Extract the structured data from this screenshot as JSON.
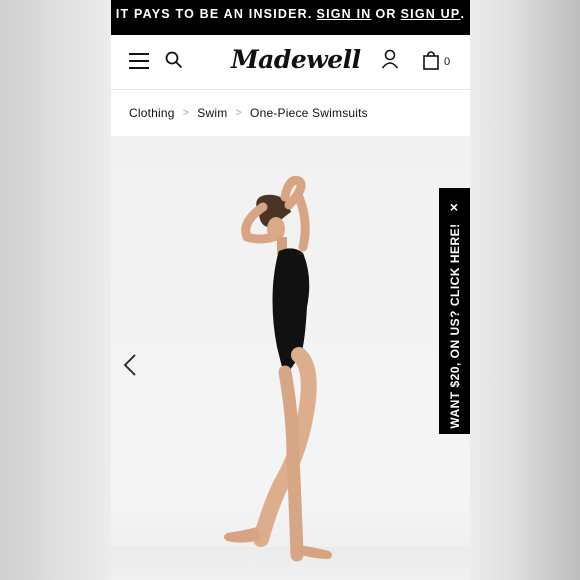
{
  "promo_bar": {
    "prefix": "IT PAYS TO BE AN INSIDER.",
    "sign_in": "SIGN IN",
    "middle": "OR",
    "sign_up": "SIGN UP",
    "suffix": "."
  },
  "header": {
    "logo": "Madewell",
    "menu_icon": "hamburger-menu-icon",
    "search_icon": "search-icon",
    "account_icon": "user-icon",
    "bag_icon": "shopping-bag-icon",
    "bag_count": "0"
  },
  "breadcrumb": {
    "items": [
      "Clothing",
      "Swim",
      "One-Piece Swimsuits"
    ],
    "separator": ">"
  },
  "hero": {
    "prev_icon": "chevron-left-icon"
  },
  "promo_tab": {
    "close": "×",
    "label": "WANT $20, ON US? CLICK HERE!"
  }
}
